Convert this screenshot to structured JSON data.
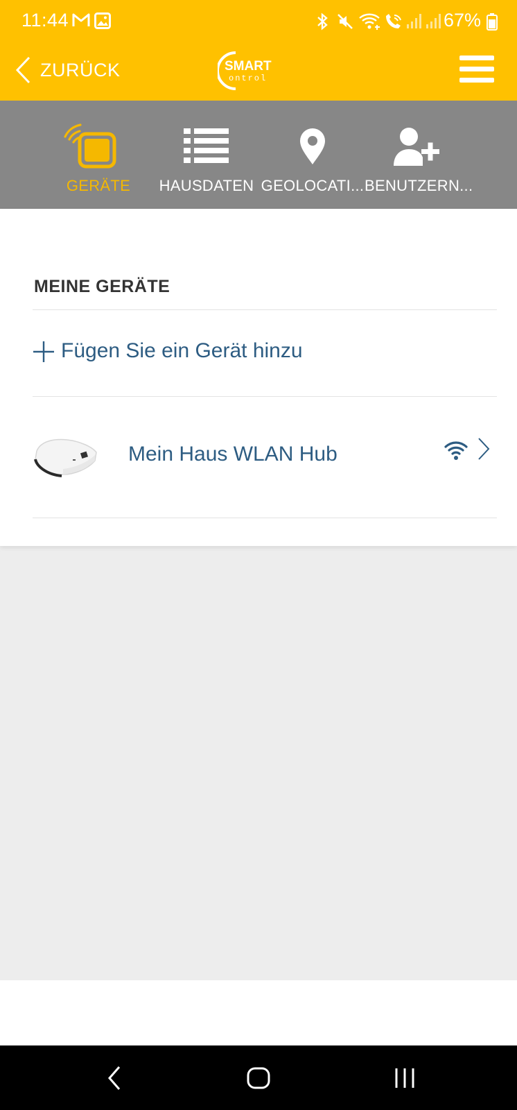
{
  "status_bar": {
    "time": "11:44",
    "battery": "67%",
    "icons": [
      "gmail-icon",
      "gallery-icon",
      "bluetooth-icon",
      "mute-icon",
      "wifi-icon",
      "wifi-calling-icon",
      "signal-icon",
      "signal-icon",
      "battery-icon"
    ]
  },
  "header": {
    "back_label": "ZURÜCK",
    "logo_text_top": "SMART",
    "logo_text_bottom": "ontrol",
    "logo_letter": "C"
  },
  "tabs": [
    {
      "label": "GERÄTE",
      "icon": "device-signal-icon",
      "active": true
    },
    {
      "label": "HAUSDATEN",
      "icon": "list-icon",
      "active": false
    },
    {
      "label": "GEOLOCATI...",
      "icon": "location-pin-icon",
      "active": false
    },
    {
      "label": "BENUTZERN...",
      "icon": "add-user-icon",
      "active": false
    }
  ],
  "main": {
    "section_title": "MEINE GERÄTE",
    "add_label": "Fügen Sie ein Gerät hinzu",
    "devices": [
      {
        "name": "Mein Haus WLAN Hub",
        "status_icon": "wifi-icon"
      }
    ]
  },
  "colors": {
    "brand_yellow": "#ffc100",
    "tab_bg": "#878787",
    "active_tab": "#f5b800",
    "link_blue": "#2d5c82"
  }
}
